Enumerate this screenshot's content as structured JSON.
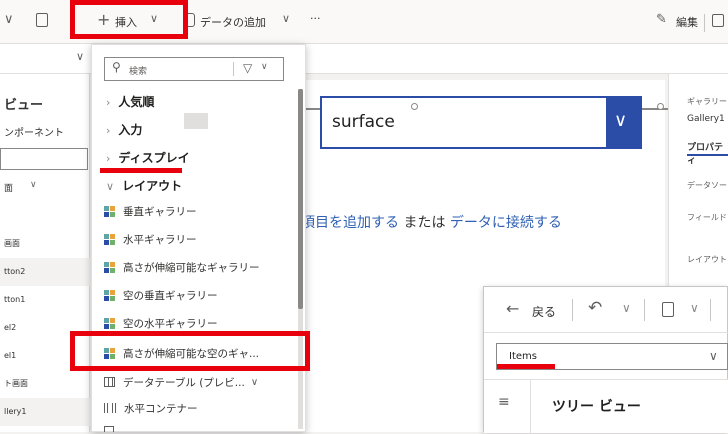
{
  "toolbar": {
    "insert_label": "挿入",
    "add_data_label": "データの追加",
    "more": "···",
    "edit_label": "編集"
  },
  "dropdown": {
    "search_placeholder": "検索",
    "categories": [
      "人気順",
      "入力",
      "ディスプレイ",
      "レイアウト"
    ],
    "items": [
      "垂直ギャラリー",
      "水平ギャラリー",
      "高さが伸縮可能なギャラリー",
      "空の垂直ギャラリー",
      "空の水平ギャラリー",
      "高さが伸縮可能な空のギャ...",
      "データテーブル (プレビ...",
      "水平コンテナー"
    ]
  },
  "leftpane": {
    "title": "ビュー",
    "subtitle": "ンポーネント",
    "filter_label": "面",
    "rows": [
      "画面",
      "tton2",
      "tton1",
      "el2",
      "el1",
      "ト画面",
      "llery1"
    ]
  },
  "canvas": {
    "dropdown_value": "surface",
    "hint_part1": "項目を追加する",
    "hint_part2": "または",
    "hint_part3": "データに接続する"
  },
  "rightpane": {
    "gallery_label": "ギャラリー",
    "gallery_name": "Gallery1",
    "properties_tab": "プロパティ",
    "data_source": "データソー",
    "fields": "フィールド",
    "layout": "レイアウト"
  },
  "panel2": {
    "back_label": "戻る",
    "property_value": "Items",
    "tree_title": "ツリー ビュー"
  },
  "colors": {
    "accent": "#2b4da8",
    "link": "#2f60b4",
    "highlight": "#e8000d"
  }
}
